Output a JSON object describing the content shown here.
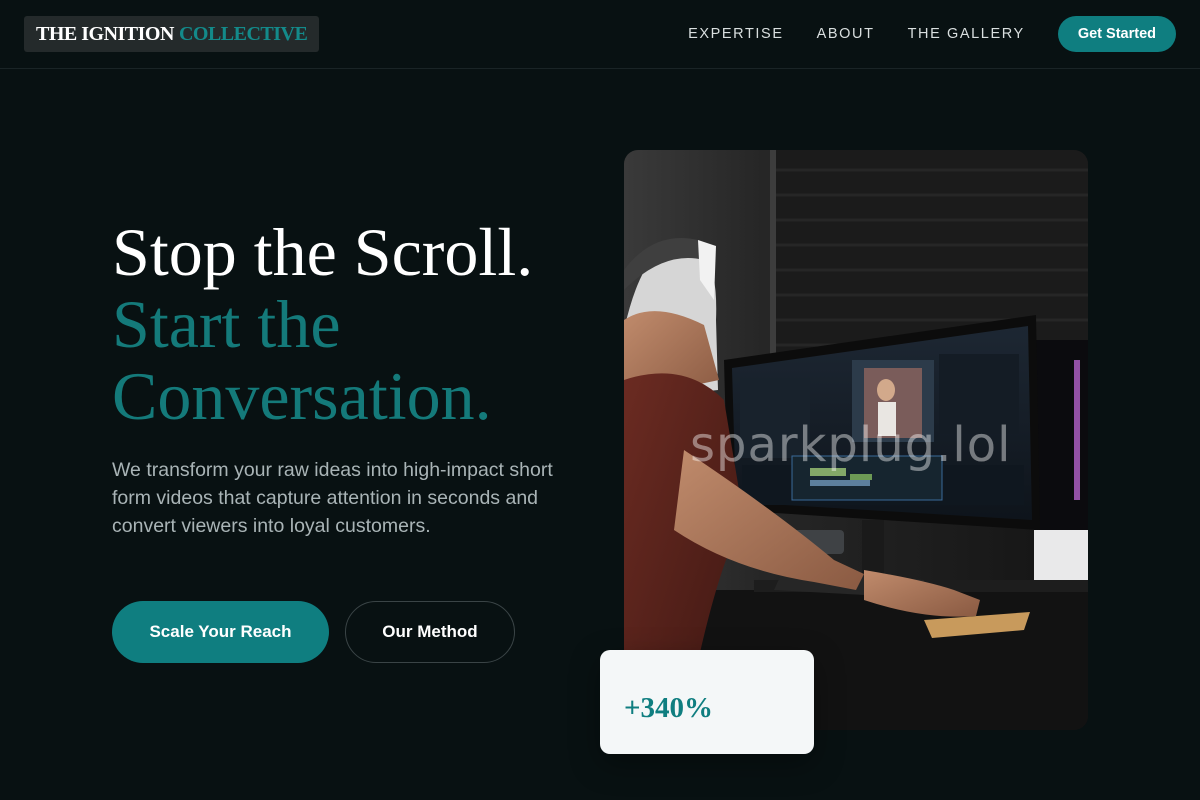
{
  "brand": {
    "name_part1": "THE IGNITION",
    "name_part2": "COLLECTIVE",
    "primary_color": "#0F7E80",
    "background": "#081112"
  },
  "nav": {
    "links": [
      "EXPERTISE",
      "ABOUT",
      "THE GALLERY"
    ],
    "cta_label": "Get Started"
  },
  "hero": {
    "headline_line1": "Stop the Scroll.",
    "headline_line2": "Start the Conversation.",
    "lead": "We transform your raw ideas into high-impact short form videos that capture attention in seconds and convert viewers into loyal customers.",
    "primary_button": "Scale Your Reach",
    "secondary_button": "Our Method",
    "image_alt": "video-editor-at-curved-monitor-photo",
    "watermark": "sparkplug.lol"
  },
  "stat": {
    "value": "+340%"
  }
}
